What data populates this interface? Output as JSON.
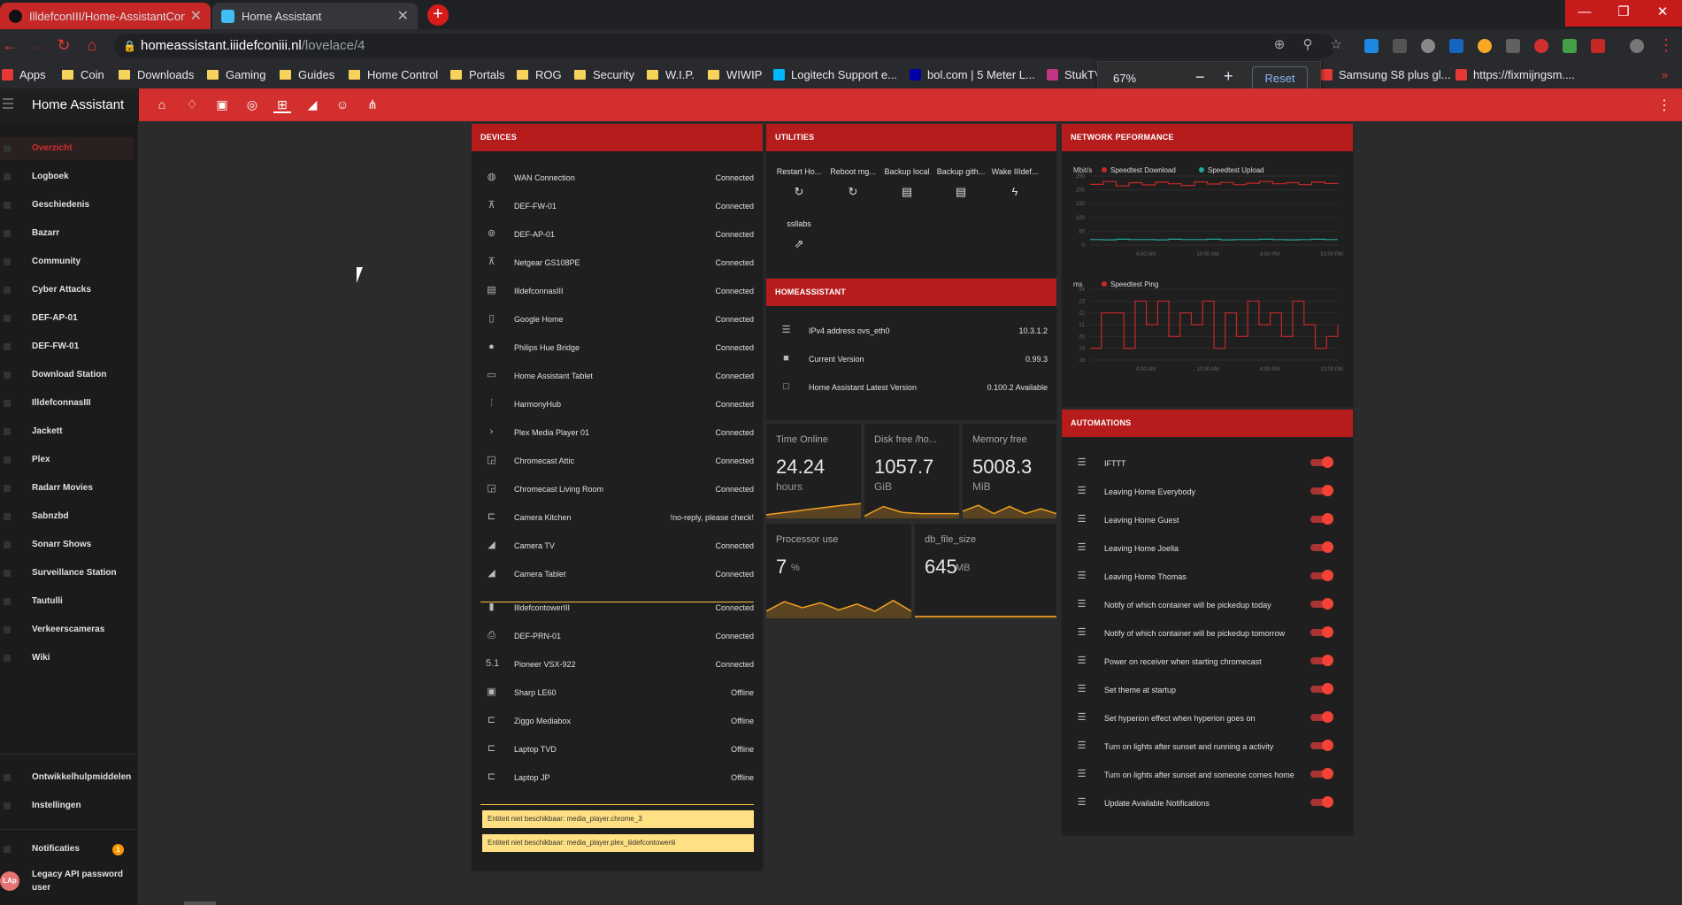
{
  "browser": {
    "tabs": [
      {
        "title": "IlldefconIII/Home-AssistantConfi",
        "active": false
      },
      {
        "title": "Home Assistant",
        "active": true
      }
    ],
    "new_tab_icon": "plus-icon",
    "url_host": "homeassistant.iiidefconiii.nl",
    "url_path": "/lovelace/4",
    "bookmarks": [
      "Apps",
      "Coin",
      "Downloads",
      "Gaming",
      "Guides",
      "Home Control",
      "Portals",
      "ROG",
      "Security",
      "W.I.P.",
      "WIWIP",
      "Logitech Support e...",
      "bol.com | 5 Meter L...",
      "StukTV",
      "Samsung S8 plus gl...",
      "https://fixmijngsm...."
    ],
    "zoom": {
      "value": "67%",
      "reset_label": "Reset"
    }
  },
  "app": {
    "title": "Home Assistant",
    "accent": "#d32f2f"
  },
  "sidebar": {
    "items": [
      "Overzicht",
      "Logboek",
      "Geschiedenis",
      "Bazarr",
      "Community",
      "Cyber Attacks",
      "DEF-AP-01",
      "DEF-FW-01",
      "Download Station",
      "IlldefconnasIII",
      "Jackett",
      "Plex",
      "Radarr Movies",
      "Sabnzbd",
      "Sonarr Shows",
      "Surveillance Station",
      "Tautulli",
      "Verkeerscameras",
      "Wiki"
    ],
    "bottom_items": [
      "Ontwikkelhulpmiddelen",
      "Instellingen"
    ],
    "notifications_label": "Notificaties",
    "notifications_count": "1",
    "user_initials": "LAp",
    "user_name": "Legacy API password user"
  },
  "devices": {
    "header": "DEVICES",
    "rows": [
      {
        "icon": "globe-icon",
        "name": "WAN Connection",
        "state": "Connected"
      },
      {
        "icon": "router-icon",
        "name": "DEF-FW-01",
        "state": "Connected"
      },
      {
        "icon": "access-point-icon",
        "name": "DEF-AP-01",
        "state": "Connected"
      },
      {
        "icon": "router-icon",
        "name": "Netgear GS108PE",
        "state": "Connected"
      },
      {
        "icon": "nas-icon",
        "name": "IlldefconnasIII",
        "state": "Connected"
      },
      {
        "icon": "speaker-icon",
        "name": "Google Home",
        "state": "Connected"
      },
      {
        "icon": "lightbulb-icon",
        "name": "Philips Hue Bridge",
        "state": "Connected"
      },
      {
        "icon": "tablet-icon",
        "name": "Home Assistant Tablet",
        "state": "Connected"
      },
      {
        "icon": "remote-icon",
        "name": "HarmonyHub",
        "state": "Connected"
      },
      {
        "icon": "plex-icon",
        "name": "Plex Media Player 01",
        "state": "Connected"
      },
      {
        "icon": "cast-icon",
        "name": "Chromecast Attic",
        "state": "Connected"
      },
      {
        "icon": "cast-icon",
        "name": "Chromecast Living Room",
        "state": "Connected"
      },
      {
        "icon": "lan-icon",
        "name": "Camera Kitchen",
        "state": "!no-reply, please check!"
      },
      {
        "icon": "cctv-icon",
        "name": "Camera TV",
        "state": "Connected"
      },
      {
        "icon": "cctv-icon",
        "name": "Camera Tablet",
        "state": "Connected"
      },
      {
        "icon": "server-icon",
        "name": "IlldefcontowerIII",
        "state": "Connected"
      },
      {
        "icon": "printer-icon",
        "name": "DEF-PRN-01",
        "state": "Connected"
      },
      {
        "icon": "surround-icon",
        "name": "Pioneer VSX-922",
        "state": "Connected"
      },
      {
        "icon": "tv-icon",
        "name": "Sharp LE60",
        "state": "Offline"
      },
      {
        "icon": "lan-icon",
        "name": "Ziggo Mediabox",
        "state": "Offline"
      },
      {
        "icon": "lan-icon",
        "name": "Laptop TVD",
        "state": "Offline"
      },
      {
        "icon": "lan-icon",
        "name": "Laptop JP",
        "state": "Offline"
      }
    ],
    "warnings": [
      "Entiteit niet beschikbaar: media_player.chrome_3",
      "Entiteit niet beschikbaar: media_player.plex_iiidefcontoweriii"
    ]
  },
  "utilities": {
    "header": "UTILITIES",
    "buttons": [
      {
        "label": "Restart Ho...",
        "icon": "restart-icon"
      },
      {
        "label": "Reboot mg...",
        "icon": "restart-icon"
      },
      {
        "label": "Backup local",
        "icon": "file-icon"
      },
      {
        "label": "Backup gith...",
        "icon": "file-icon"
      },
      {
        "label": "Wake IIIdef...",
        "icon": "flash-icon"
      },
      {
        "label": "ssllabs",
        "icon": "open-in-new-icon"
      }
    ]
  },
  "homeassistant": {
    "header": "HOMEASSISTANT",
    "rows": [
      {
        "icon": "server-network-icon",
        "name": "IPv4 address ovs_eth0",
        "state": "10.3.1.2"
      },
      {
        "icon": "package-icon",
        "name": "Current Version",
        "state": "0.99.3"
      },
      {
        "icon": "checkbox-icon",
        "name": "Home Assistant Latest Version",
        "state": "0.100.2 Available"
      }
    ]
  },
  "sensors": [
    {
      "name": "Time Online",
      "value": "24.24",
      "unit": "hours",
      "history": [
        0.15,
        0.25,
        0.35,
        0.45,
        0.55,
        0.62
      ]
    },
    {
      "name": "Disk free /ho...",
      "value": "1057.7",
      "unit": "GiB",
      "history": [
        0.1,
        0.5,
        0.25,
        0.2,
        0.2,
        0.2
      ]
    },
    {
      "name": "Memory free",
      "value": "5008.3",
      "unit": "MiB",
      "history": [
        0.3,
        0.55,
        0.2,
        0.5,
        0.2,
        0.4,
        0.2
      ]
    },
    {
      "name": "Processor use",
      "value": "7",
      "unit": "%",
      "history": [
        0.3,
        0.7,
        0.45,
        0.65,
        0.35,
        0.6,
        0.3,
        0.75,
        0.3
      ]
    },
    {
      "name": "db_file_size",
      "value": "645",
      "unit": "MB",
      "history": [
        0.08,
        0.08,
        0.08,
        0.08
      ]
    }
  ],
  "network": {
    "header": "NETWORK PEFORMANCE"
  },
  "chart_data": [
    {
      "type": "line",
      "ylabel": "Mbit/s",
      "y_ticks": [
        "250",
        "200",
        "150",
        "100",
        "50",
        "0"
      ],
      "ylim": [
        0,
        250
      ],
      "x_ticks": [
        "4:00 AM",
        "10:00 AM",
        "4:00 PM",
        "10:00 PM"
      ],
      "series": [
        {
          "name": "Speedtest Download",
          "color": "#c62828",
          "values": [
            220,
            230,
            214,
            226,
            218,
            228,
            222,
            216,
            229,
            221,
            227,
            219,
            224,
            230,
            222,
            226,
            219,
            228,
            223,
            225
          ]
        },
        {
          "name": "Speedtest Upload",
          "color": "#26a69a",
          "values": [
            20,
            19,
            21,
            20,
            20,
            19,
            21,
            20,
            20,
            21,
            19,
            20,
            20,
            21,
            20,
            19,
            20,
            21,
            20,
            20
          ]
        }
      ]
    },
    {
      "type": "line",
      "ylabel": "ms",
      "y_ticks": [
        "24",
        "23",
        "22",
        "21",
        "20",
        "19",
        "18"
      ],
      "ylim": [
        18,
        24
      ],
      "x_ticks": [
        "4:00 AM",
        "10:00 AM",
        "4:00 PM",
        "10:00 PM"
      ],
      "series": [
        {
          "name": "Speedtest Ping",
          "color": "#c62828",
          "values": [
            19,
            22,
            22,
            19,
            23,
            21,
            23,
            20,
            22,
            21,
            23,
            19,
            22,
            20,
            23,
            21,
            22,
            20,
            23,
            21,
            19,
            20,
            21
          ]
        }
      ]
    }
  ],
  "automations": {
    "header": "AUTOMATIONS",
    "rows": [
      "IFTTT",
      "Leaving Home Everybody",
      "Leaving Home Guest",
      "Leaving Home Joella",
      "Leaving Home Thomas",
      "Notify of which container will be pickedup today",
      "Notify of which container will be pickedup tomorrow",
      "Power on receiver when starting chromecast",
      "Set theme at startup",
      "Set hyperion effect when hyperion goes on",
      "Turn on lights after sunset and running a activity",
      "Turn on lights after sunset and someone comes home",
      "Update Available Notifications"
    ]
  }
}
